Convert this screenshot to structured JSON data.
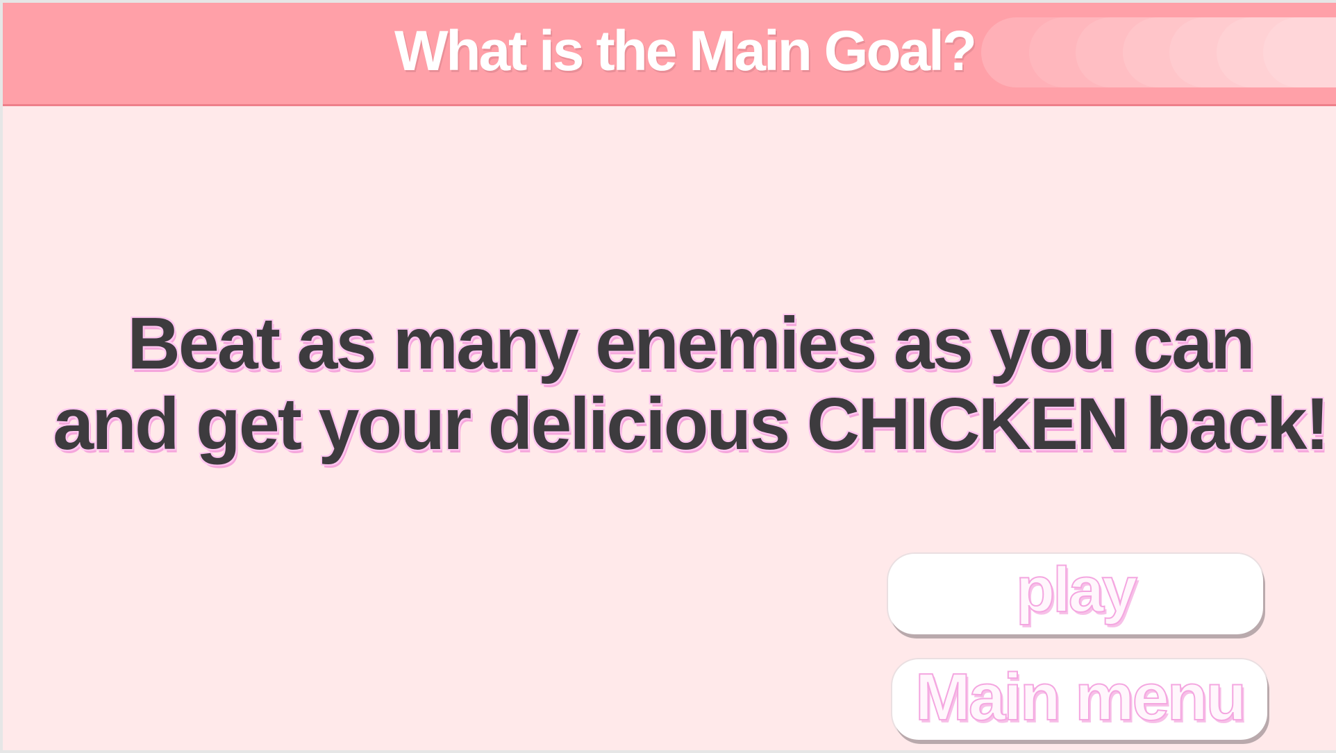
{
  "header": {
    "title": "What is the Main Goal?"
  },
  "goal": {
    "line1": "Beat as many enemies as you can",
    "line2": "and get your delicious CHICKEN back!"
  },
  "buttons": {
    "play_label": "play",
    "main_menu_label": "Main menu"
  },
  "colors": {
    "background": "#ffe9ea",
    "header": "#ffa0a8",
    "text_dark": "#3d3b3e",
    "button_text_outline": "#f4a6e0"
  }
}
